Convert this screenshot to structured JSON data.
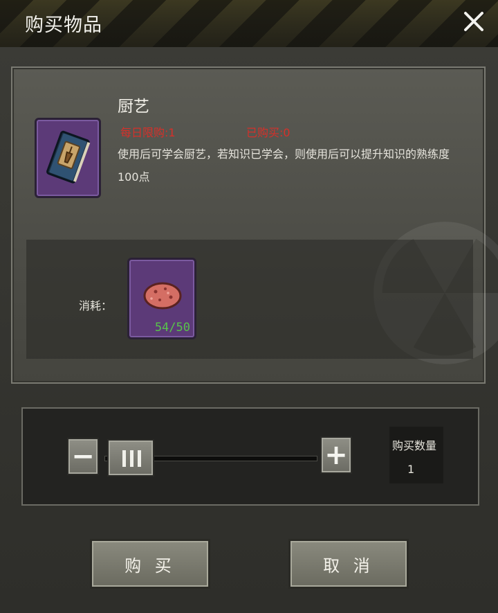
{
  "dialog": {
    "title": "购买物品",
    "close_icon": "close-icon"
  },
  "item": {
    "name": "厨艺",
    "daily_limit_text": "每日限购:1",
    "purchased_text": "已购买:0",
    "description": "使用后可学会厨艺，若知识已学会，则使用后可以提升知识的熟练度100点",
    "icon": "recipe-book-icon"
  },
  "cost": {
    "label": "消耗：",
    "item_icon": "potato-icon",
    "count_text": "54/50"
  },
  "quantity": {
    "minus_label": "−",
    "plus_label": "+",
    "label": "购买数量",
    "value": "1",
    "slider_fraction": 0.0
  },
  "buttons": {
    "buy_label": "购 买",
    "cancel_label": "取 消"
  },
  "colors": {
    "limit_text": "#d6302a",
    "count_text": "#58c34a",
    "item_frame": "#5c3a78"
  }
}
